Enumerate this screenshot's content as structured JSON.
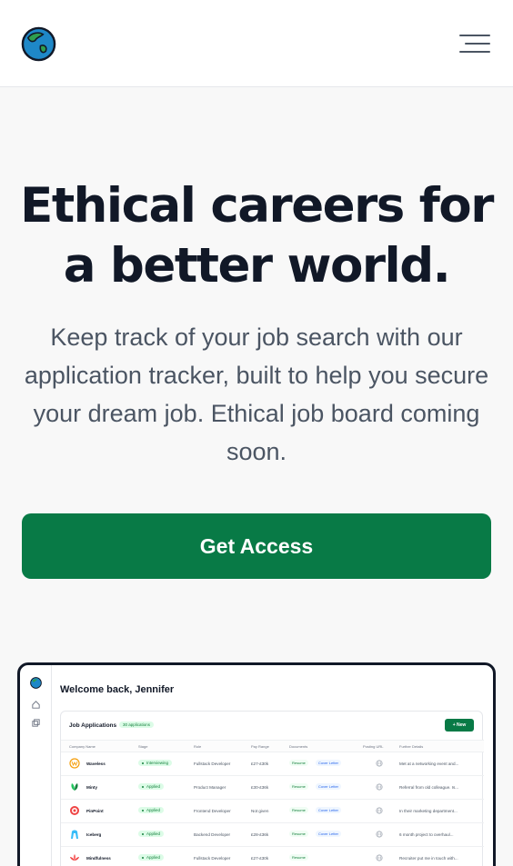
{
  "hero": {
    "title_line1": "Ethical careers for",
    "title_line2": "a better world.",
    "subtitle": "Keep track of your job search with our application tracker, built to help you secure your dream job. Ethical job board coming soon.",
    "cta_label": "Get Access"
  },
  "colors": {
    "brand_green": "#087a46",
    "text_dark": "#111827",
    "text_muted": "#4b5563"
  },
  "preview": {
    "welcome": "Welcome back, Jennifer",
    "card_title": "Job Applications",
    "count_badge": "30 applications",
    "new_button": "New",
    "columns": [
      "Company Name",
      "Stage",
      "Role",
      "Pay Range",
      "Documents",
      "Posting URL",
      "Further Details"
    ],
    "rows": [
      {
        "company": "Waveless",
        "stage": "Interviewing",
        "role": "Fullstack Developer",
        "pay": "£27-£30k",
        "resume": "Resume",
        "cover": "Cover Letter",
        "details": "Met at a networking event and..."
      },
      {
        "company": "Minty",
        "stage": "Applied",
        "role": "Product Manager",
        "pay": "£30-£36k",
        "resume": "Resume",
        "cover": "Cover Letter",
        "details": "Referral from old colleague. Is..."
      },
      {
        "company": "PinPoint",
        "stage": "Applied",
        "role": "Frontend Developer",
        "pay": "Not given",
        "resume": "Resume",
        "cover": "Cover Letter",
        "details": "In their marketing department..."
      },
      {
        "company": "Iceberg",
        "stage": "Applied",
        "role": "Backend Developer",
        "pay": "£28-£36k",
        "resume": "Resume",
        "cover": "Cover Letter",
        "details": "6 month project to overhaul..."
      },
      {
        "company": "Mindfulness",
        "stage": "Applied",
        "role": "Fullstack Developer",
        "pay": "£27-£30k",
        "resume": "Resume",
        "cover": "",
        "details": "Recruiter put me in touch with..."
      }
    ]
  }
}
